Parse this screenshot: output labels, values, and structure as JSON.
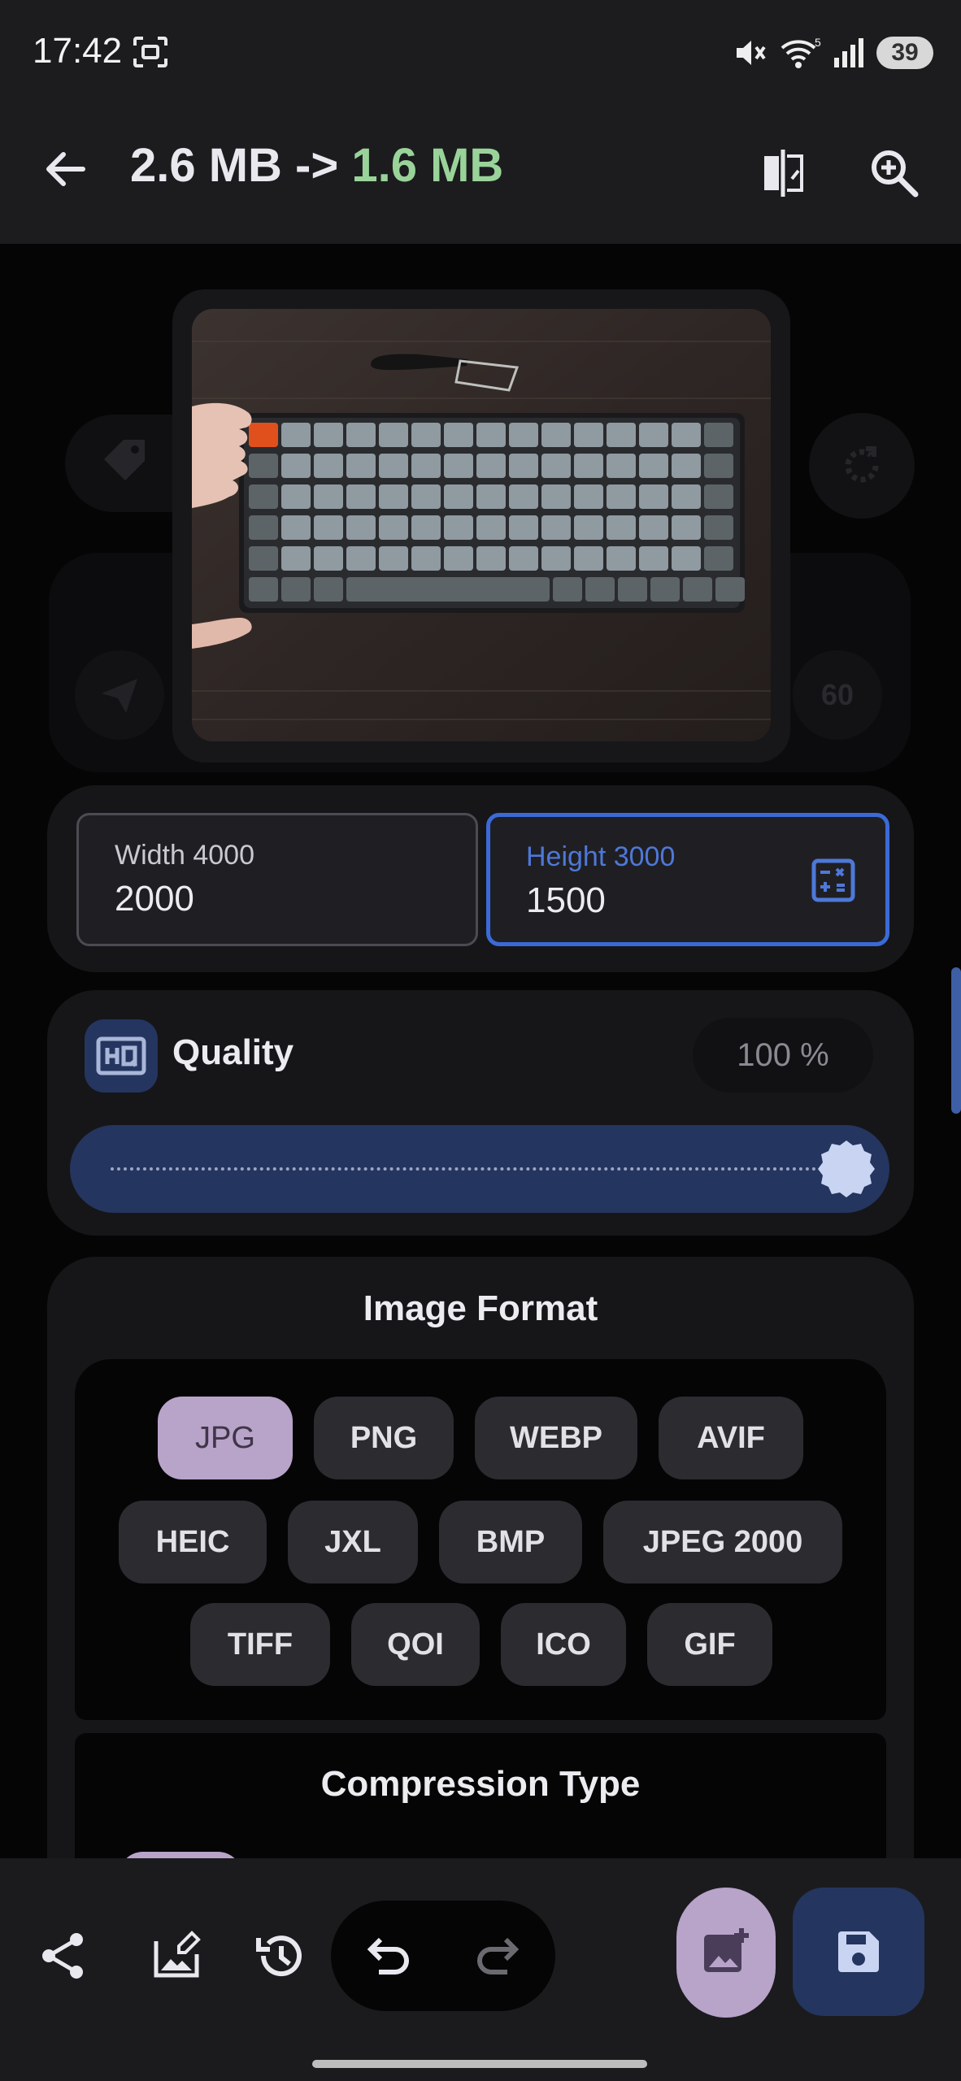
{
  "status_bar": {
    "time": "17:42",
    "battery": "39",
    "network": "5"
  },
  "toolbar": {
    "size_before": "2.6 MB ->",
    "size_after": "1.6 MB",
    "accent": "#9ad39a"
  },
  "side_controls": {
    "quality_readout": "60"
  },
  "resize": {
    "width_label": "Width 4000",
    "width_value": "2000",
    "height_label": "Height 3000",
    "height_value": "1500"
  },
  "quality": {
    "label": "Quality",
    "value_text": "100 %",
    "level_percent": 100
  },
  "image_format": {
    "title": "Image Format",
    "selected": "JPG",
    "rows": [
      [
        "JPG",
        "PNG",
        "WEBP",
        "AVIF"
      ],
      [
        "HEIC",
        "JXL",
        "BMP",
        "JPEG 2000"
      ],
      [
        "TIFF",
        "QOI",
        "ICO",
        "GIF"
      ]
    ]
  },
  "compression": {
    "title": "Compression Type"
  },
  "colors": {
    "accent_blue": "#24355f",
    "accent_purple": "#b8a3c9",
    "field_focus": "#3b6ad8"
  }
}
